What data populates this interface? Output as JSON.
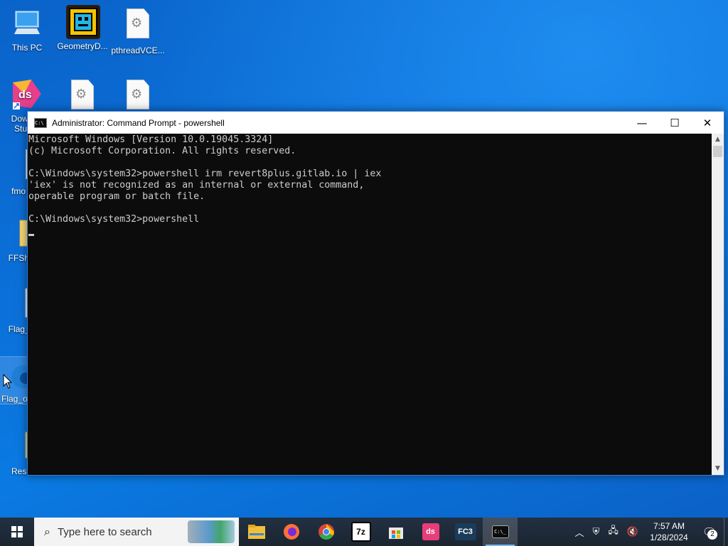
{
  "desktop": {
    "icons": [
      {
        "label": "This PC",
        "icon": "this-pc-icon"
      },
      {
        "label": "GeometryD...",
        "icon": "geometry-dash-icon"
      },
      {
        "label": "pthreadVCE...",
        "icon": "dll-file-icon"
      },
      {
        "label": "Dowl\nStu",
        "icon": "ds-app-shortcut-icon"
      },
      {
        "label": "",
        "icon": "settings-file-icon"
      },
      {
        "label": "",
        "icon": "settings-file-icon"
      },
      {
        "label": "fmo",
        "icon": "settings-file-icon"
      },
      {
        "label": "FFShift",
        "icon": "folder-icon"
      },
      {
        "label": "Flag_o",
        "icon": "document-icon"
      },
      {
        "label": "Flag_o",
        "icon": "edge-icon"
      },
      {
        "label": "Reso",
        "icon": "folder-icon"
      }
    ]
  },
  "window": {
    "title": "Administrator: Command Prompt - powershell",
    "console_text": "Microsoft Windows [Version 10.0.19045.3324]\n(c) Microsoft Corporation. All rights reserved.\n\nC:\\Windows\\system32>powershell irm revert8plus.gitlab.io | iex\n'iex' is not recognized as an internal or external command,\noperable program or batch file.\n\nC:\\Windows\\system32>powershell\n",
    "minimize": "—",
    "maximize": "☐",
    "close": "✕"
  },
  "taskbar": {
    "search_placeholder": "Type here to search",
    "apps": [
      {
        "name": "file-explorer",
        "label": "",
        "color": "#f2c037"
      },
      {
        "name": "firefox",
        "label": "",
        "color": "#ff7139"
      },
      {
        "name": "chrome",
        "label": "",
        "color": "#34a853"
      },
      {
        "name": "7zip",
        "label": "7z",
        "color": "#ffffff"
      },
      {
        "name": "microsoft-store",
        "label": "",
        "color": "#0078d4"
      },
      {
        "name": "ds-app",
        "label": "ds",
        "color": "#e93c7a"
      },
      {
        "name": "fc3",
        "label": "FC3",
        "color": "#1a3c5a"
      },
      {
        "name": "command-prompt",
        "label": "C:\\_",
        "color": "#0c0c0c",
        "active": true
      }
    ],
    "clock_time": "7:57 AM",
    "clock_date": "1/28/2024",
    "notification_count": "2"
  }
}
